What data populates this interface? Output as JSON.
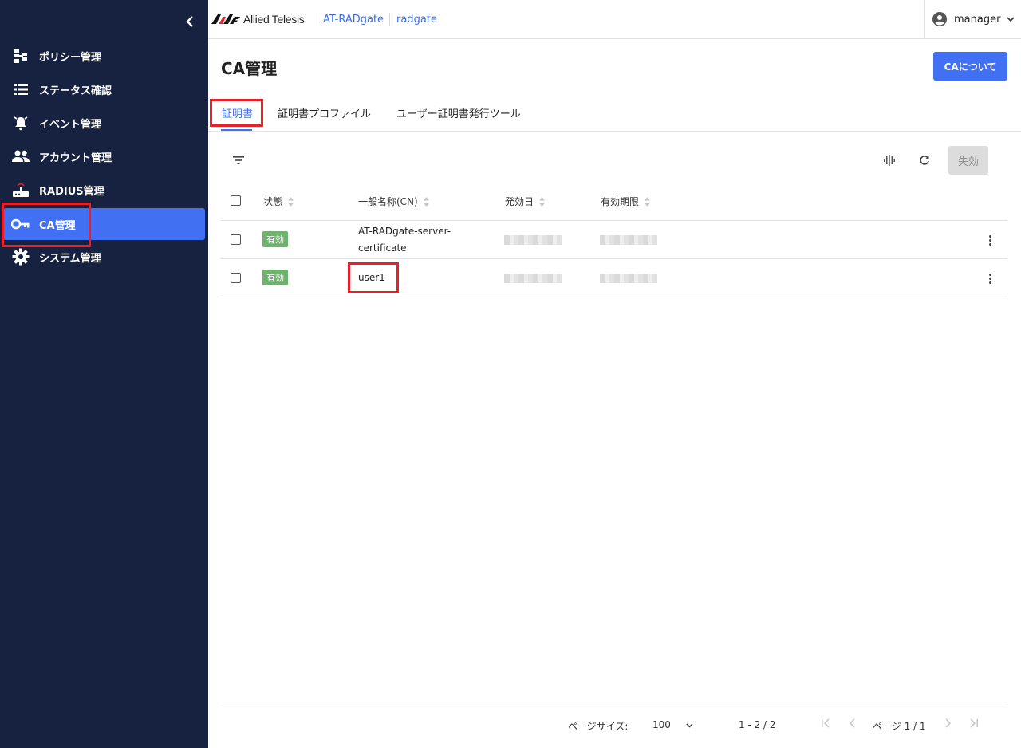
{
  "sidebar": {
    "items": [
      {
        "label": "ポリシー管理",
        "icon": "policy-tree-icon"
      },
      {
        "label": "ステータス確認",
        "icon": "list-icon"
      },
      {
        "label": "イベント管理",
        "icon": "alarm-bell-icon"
      },
      {
        "label": "アカウント管理",
        "icon": "people-icon"
      },
      {
        "label": "RADIUS管理",
        "icon": "router-icon"
      },
      {
        "label": "CA管理",
        "icon": "key-icon",
        "active": true
      },
      {
        "label": "システム管理",
        "icon": "gear-icon"
      }
    ]
  },
  "header": {
    "brand": "Allied Telesis",
    "product": "AT-RADgate",
    "host": "radgate",
    "user": "manager"
  },
  "page": {
    "title": "CA管理",
    "about_button": "CAについて"
  },
  "tabs": [
    {
      "label": "証明書",
      "active": true
    },
    {
      "label": "証明書プロファイル"
    },
    {
      "label": "ユーザー証明書発行ツール"
    }
  ],
  "toolbar": {
    "disable_button": "失効"
  },
  "table": {
    "columns": [
      "状態",
      "一般名称(CN)",
      "発効日",
      "有効期限"
    ],
    "rows": [
      {
        "status": "有効",
        "cn_line1": "AT-RADgate-server-",
        "cn_line2": "certificate"
      },
      {
        "status": "有効",
        "cn_line1": "user1",
        "cn_line2": ""
      }
    ]
  },
  "pagination": {
    "page_size_label": "ページサイズ:",
    "page_size": "100",
    "range": "1 - 2 / 2",
    "page": "ページ 1 / 1"
  },
  "colors": {
    "sidebar_bg": "#172140",
    "accent": "#4170f2",
    "active_badge": "#6db36d",
    "highlight": "#e8202a"
  }
}
